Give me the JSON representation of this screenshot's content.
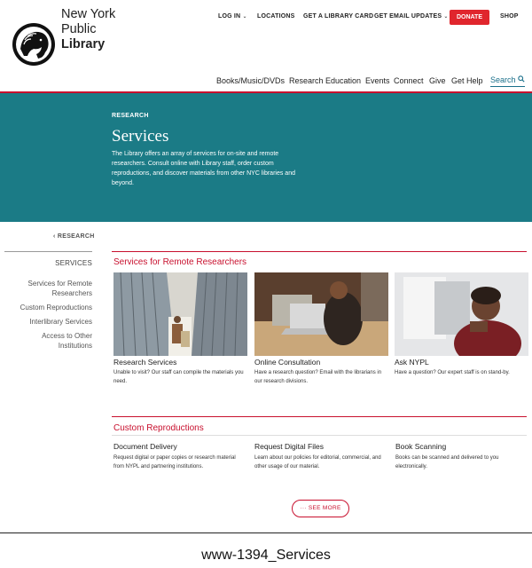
{
  "logo": {
    "line1": "New York",
    "line2": "Public",
    "line3": "Library"
  },
  "utility_nav": [
    {
      "label": "LOG IN",
      "caret": "⌄"
    },
    {
      "label": "LOCATIONS"
    },
    {
      "label": "GET A LIBRARY CARD"
    },
    {
      "label": "GET EMAIL UPDATES",
      "caret": "⌄"
    }
  ],
  "donate_label": "DONATE",
  "shop_label": "SHOP",
  "main_nav": [
    "Books/Music/DVDs",
    "Research",
    "Education",
    "Events",
    "Connect",
    "Give",
    "Get Help"
  ],
  "search_label": "Search",
  "hero": {
    "kicker": "RESEARCH",
    "title": "Services",
    "description": "The Library offers an array of services for on-site and remote researchers. Consult online with Library staff, order custom reproductions, and discover materials from other NYC libraries and beyond."
  },
  "sidebar": {
    "breadcrumb": "‹  RESEARCH",
    "heading": "SERVICES",
    "links": [
      "Services for Remote Researchers",
      "Custom Reproductions",
      "Interlibrary Services",
      "Access to Other Institutions"
    ]
  },
  "remote": {
    "title": "Services for Remote Researchers",
    "cards": [
      {
        "title": "Research Services",
        "desc": "Unable to visit? Our staff can compile the materials you need."
      },
      {
        "title": "Online Consultation",
        "desc": "Have a research question? Email with the librarians in our research divisions."
      },
      {
        "title": "Ask NYPL",
        "desc": "Have a question? Our expert staff is on stand-by."
      }
    ]
  },
  "reproductions": {
    "title": "Custom Reproductions",
    "items": [
      {
        "title": "Document Delivery",
        "desc": "Request digital or paper copies or research material from NYPL and partnering institutions."
      },
      {
        "title": "Request Digital Files",
        "desc": "Learn about our policies for editorial, commercial, and other usage of our material."
      },
      {
        "title": "Book Scanning",
        "desc": "Books can be scanned and delivered to you electronically."
      }
    ]
  },
  "see_more": "··· SEE MORE",
  "caption": "www-1394_Services",
  "colors": {
    "accent_red": "#c8102e",
    "donate_red": "#e0262d",
    "hero_teal": "#1b7b86",
    "link_teal": "#1a6f8a"
  }
}
